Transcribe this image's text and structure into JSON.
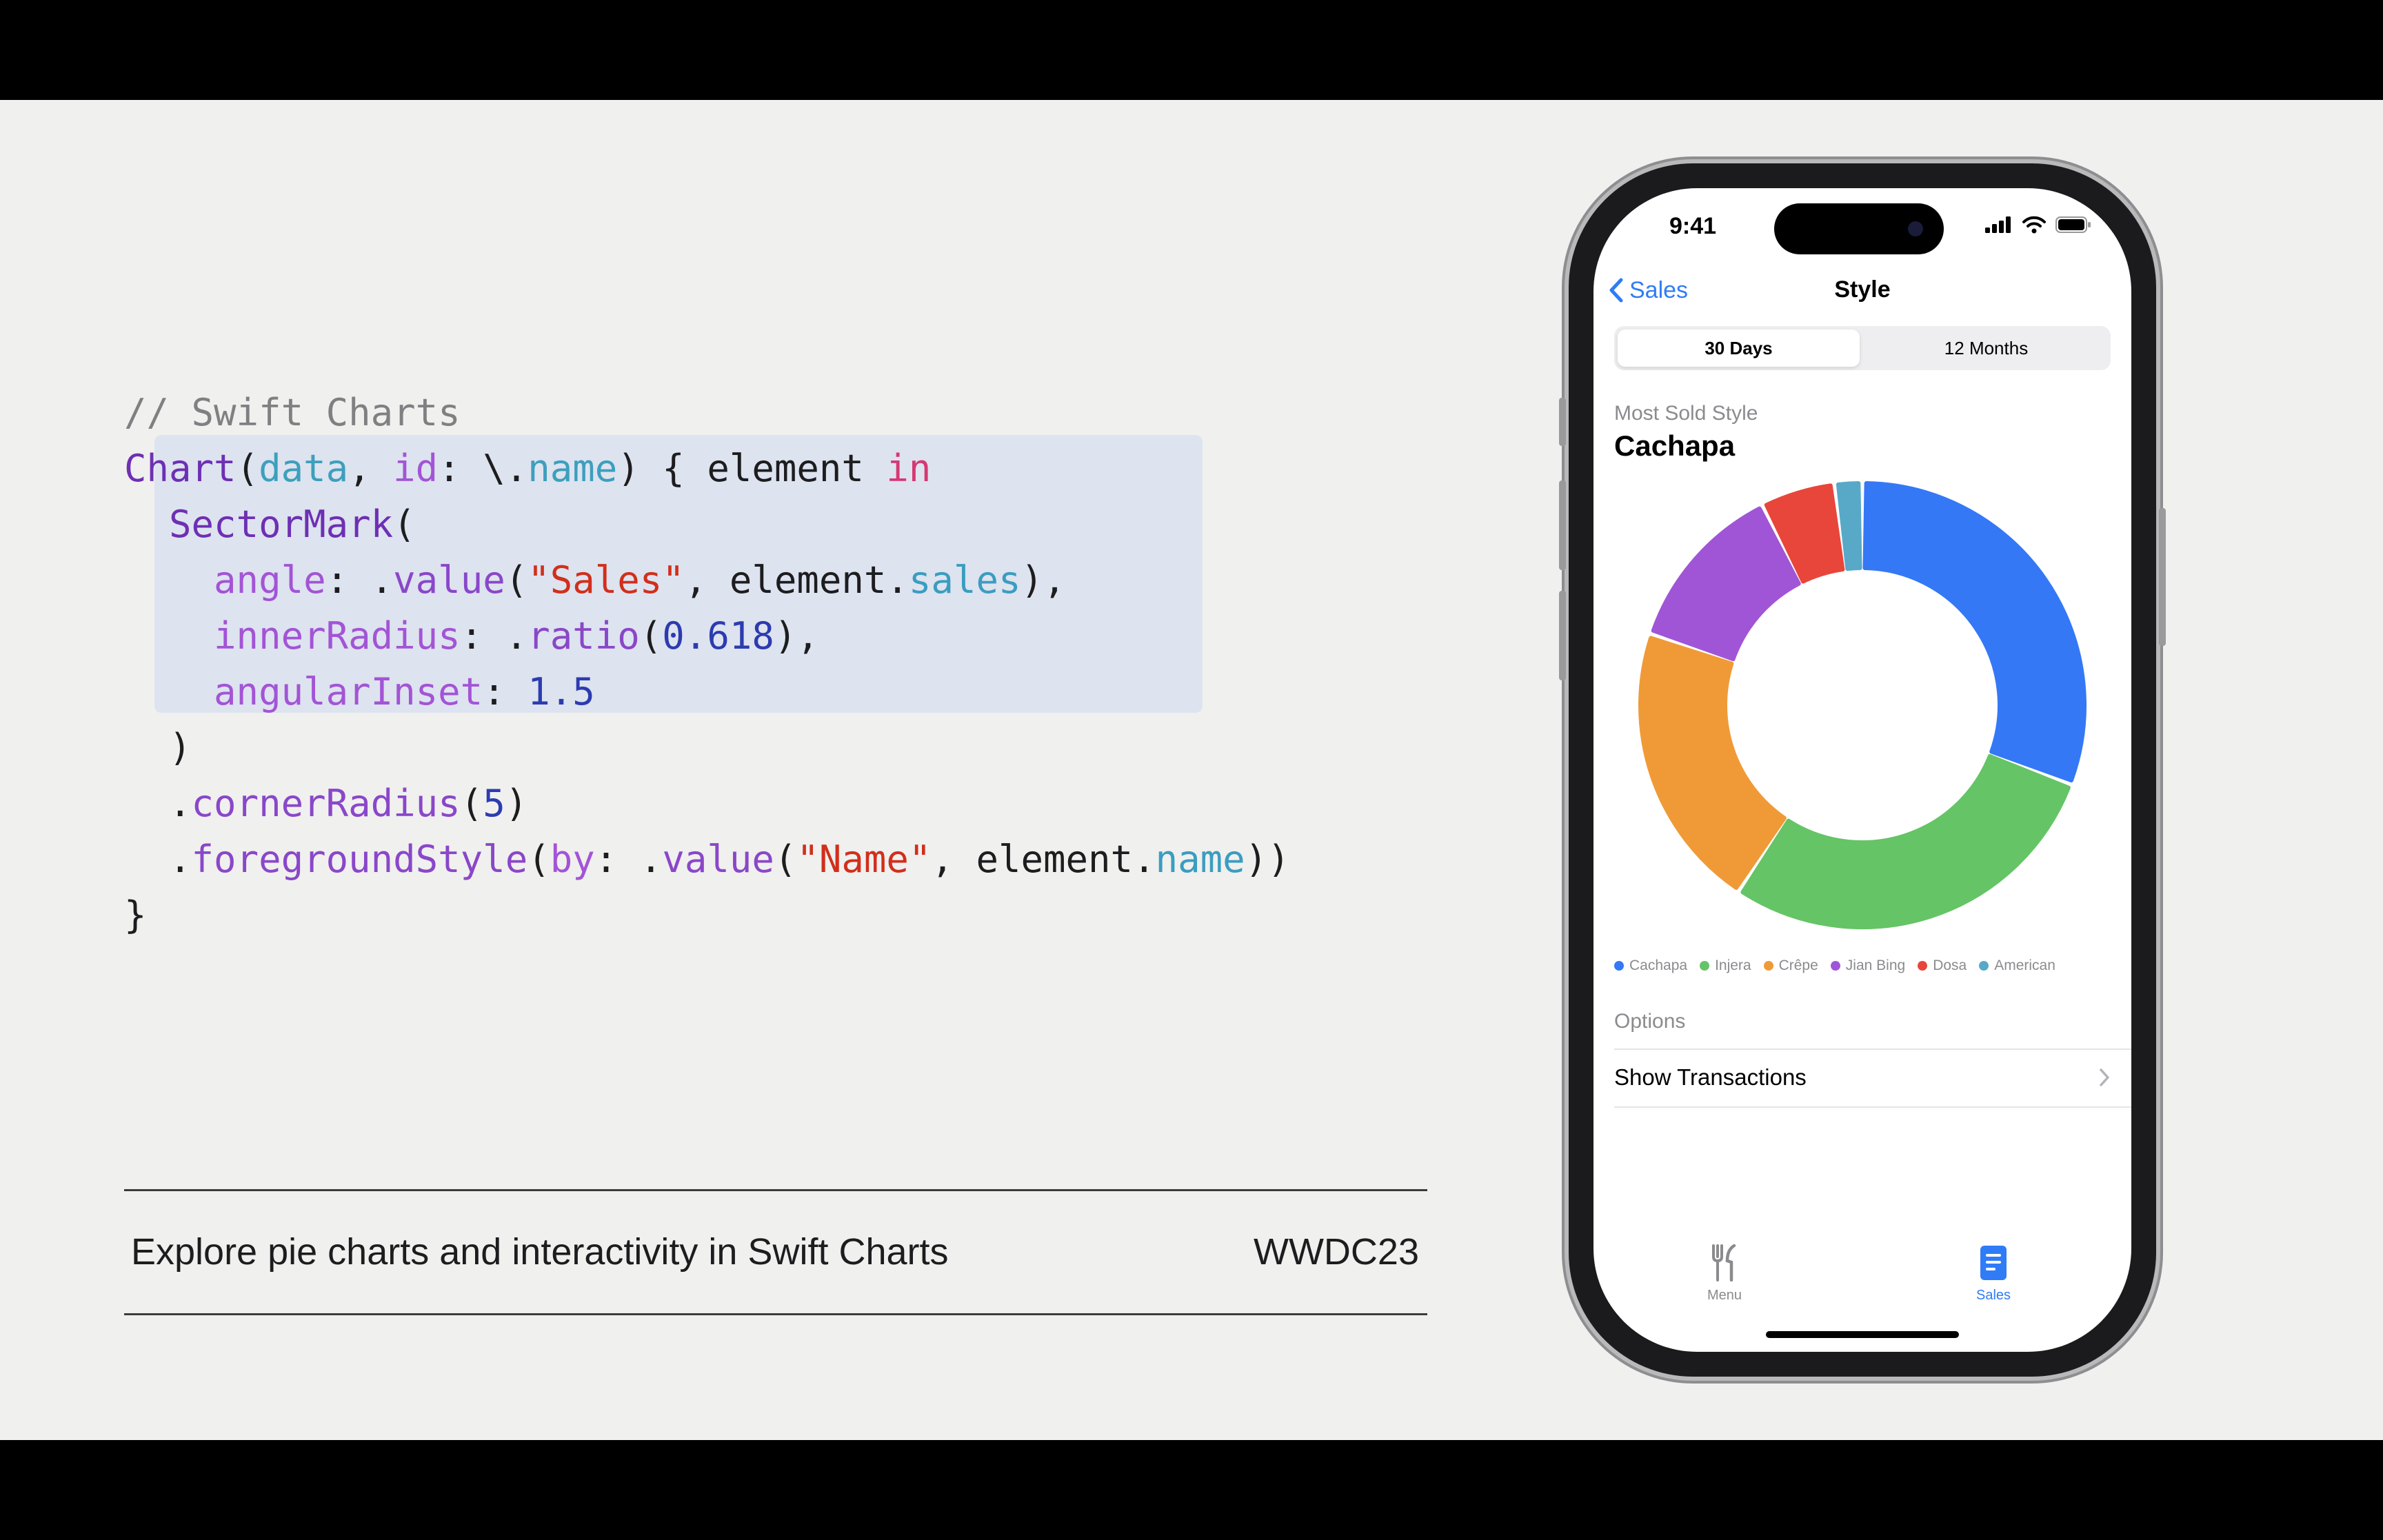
{
  "code": {
    "lines": [
      [
        {
          "t": "// Swift Charts",
          "c": "c-comment"
        }
      ],
      [
        {
          "t": "Chart",
          "c": "c-type"
        },
        {
          "t": "(",
          "c": ""
        },
        {
          "t": "data",
          "c": "c-param"
        },
        {
          "t": ", ",
          "c": ""
        },
        {
          "t": "id",
          "c": "c-label"
        },
        {
          "t": ": \\.",
          "c": ""
        },
        {
          "t": "name",
          "c": "c-param"
        },
        {
          "t": ") { element ",
          "c": ""
        },
        {
          "t": "in",
          "c": "c-kw"
        }
      ],
      [
        {
          "t": "  ",
          "c": ""
        },
        {
          "t": "SectorMark",
          "c": "c-type"
        },
        {
          "t": "(",
          "c": ""
        }
      ],
      [
        {
          "t": "    ",
          "c": ""
        },
        {
          "t": "angle",
          "c": "c-label"
        },
        {
          "t": ": .",
          "c": ""
        },
        {
          "t": "value",
          "c": "c-method"
        },
        {
          "t": "(",
          "c": ""
        },
        {
          "t": "\"Sales\"",
          "c": "c-str"
        },
        {
          "t": ", element.",
          "c": ""
        },
        {
          "t": "sales",
          "c": "c-prop"
        },
        {
          "t": "),",
          "c": ""
        }
      ],
      [
        {
          "t": "    ",
          "c": ""
        },
        {
          "t": "innerRadius",
          "c": "c-label"
        },
        {
          "t": ": .",
          "c": ""
        },
        {
          "t": "ratio",
          "c": "c-method"
        },
        {
          "t": "(",
          "c": ""
        },
        {
          "t": "0.618",
          "c": "c-num"
        },
        {
          "t": "),",
          "c": ""
        }
      ],
      [
        {
          "t": "    ",
          "c": ""
        },
        {
          "t": "angularInset",
          "c": "c-label"
        },
        {
          "t": ": ",
          "c": ""
        },
        {
          "t": "1.5",
          "c": "c-num"
        }
      ],
      [
        {
          "t": "  )",
          "c": ""
        }
      ],
      [
        {
          "t": "  .",
          "c": ""
        },
        {
          "t": "cornerRadius",
          "c": "c-method"
        },
        {
          "t": "(",
          "c": ""
        },
        {
          "t": "5",
          "c": "c-num"
        },
        {
          "t": ")",
          "c": ""
        }
      ],
      [
        {
          "t": "  .",
          "c": ""
        },
        {
          "t": "foregroundStyle",
          "c": "c-method"
        },
        {
          "t": "(",
          "c": ""
        },
        {
          "t": "by",
          "c": "c-label"
        },
        {
          "t": ": .",
          "c": ""
        },
        {
          "t": "value",
          "c": "c-method"
        },
        {
          "t": "(",
          "c": ""
        },
        {
          "t": "\"Name\"",
          "c": "c-str"
        },
        {
          "t": ", element.",
          "c": ""
        },
        {
          "t": "name",
          "c": "c-prop"
        },
        {
          "t": "))",
          "c": ""
        }
      ],
      [
        {
          "t": "}",
          "c": ""
        }
      ]
    ]
  },
  "footer": {
    "title": "Explore pie charts and interactivity in Swift Charts",
    "event": "WWDC23"
  },
  "phone": {
    "time": "9:41",
    "nav": {
      "back_label": "Sales",
      "title": "Style"
    },
    "segments": {
      "selected": "30 Days",
      "other": "12 Months"
    },
    "subtitle": "Most Sold Style",
    "headline": "Cachapa",
    "options_label": "Options",
    "row_label": "Show Transactions",
    "tabs": {
      "menu": "Menu",
      "sales": "Sales"
    }
  },
  "chart_data": {
    "type": "pie",
    "inner_radius_ratio": 0.618,
    "categories": [
      "Cachapa",
      "Injera",
      "Crêpe",
      "Jian Bing",
      "Dosa",
      "American"
    ],
    "values": [
      916,
      850,
      620,
      370,
      160,
      60
    ],
    "colors": [
      "#3478f6",
      "#65c466",
      "#f09a37",
      "#a055d6",
      "#e8463a",
      "#58a9c7"
    ],
    "legend": "bottom"
  }
}
